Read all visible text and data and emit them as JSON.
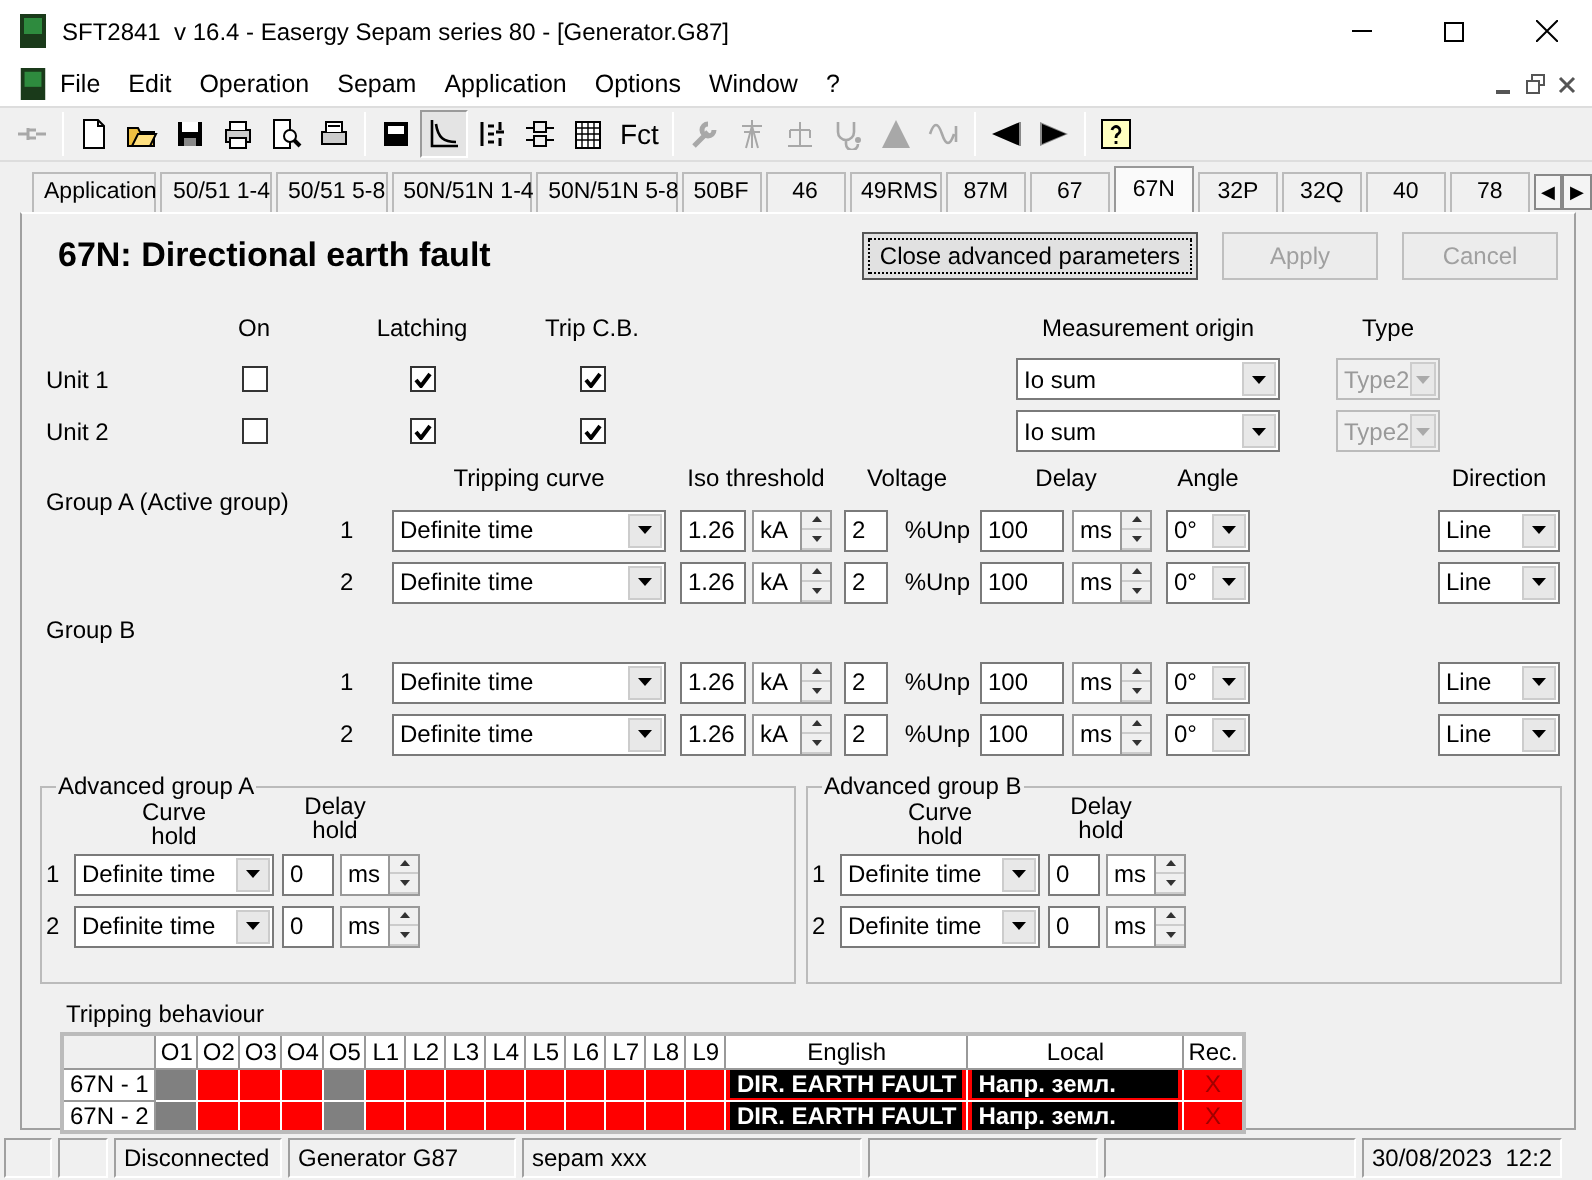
{
  "window": {
    "title": "SFT2841  v 16.4 - Easergy Sepam series 80 - [Generator.G87]"
  },
  "menu": [
    "File",
    "Edit",
    "Operation",
    "Sepam",
    "Application",
    "Options",
    "Window",
    "?"
  ],
  "toolbar": {
    "function_label": "Fct",
    "buttons": [
      {
        "disabled": true,
        "pressed": false
      },
      {
        "disabled": false,
        "pressed": false
      },
      {
        "disabled": false,
        "pressed": false
      },
      {
        "disabled": false,
        "pressed": false
      },
      {
        "disabled": false,
        "pressed": false
      },
      {
        "disabled": false,
        "pressed": false
      },
      {
        "disabled": false,
        "pressed": false
      },
      {
        "disabled": false,
        "pressed": false
      },
      {
        "disabled": false,
        "pressed": true
      },
      {
        "disabled": false,
        "pressed": false
      },
      {
        "disabled": false,
        "pressed": false
      },
      {
        "disabled": false,
        "pressed": false
      },
      {
        "disabled": true,
        "pressed": false
      },
      {
        "disabled": true,
        "pressed": false
      },
      {
        "disabled": true,
        "pressed": false
      },
      {
        "disabled": true,
        "pressed": false
      },
      {
        "disabled": true,
        "pressed": false
      },
      {
        "disabled": true,
        "pressed": false
      },
      {
        "disabled": false,
        "pressed": false
      },
      {
        "disabled": false,
        "pressed": false
      },
      {
        "disabled": false,
        "pressed": false
      }
    ]
  },
  "tabs": [
    {
      "label": "Application",
      "selected": false
    },
    {
      "label": "50/51 1-4",
      "selected": false
    },
    {
      "label": "50/51 5-8",
      "selected": false
    },
    {
      "label": "50N/51N 1-4",
      "selected": false
    },
    {
      "label": "50N/51N 5-8",
      "selected": false
    },
    {
      "label": "50BF",
      "selected": false
    },
    {
      "label": "46",
      "selected": false
    },
    {
      "label": "49RMS",
      "selected": false
    },
    {
      "label": "87M",
      "selected": false
    },
    {
      "label": "67",
      "selected": false
    },
    {
      "label": "67N",
      "selected": true
    },
    {
      "label": "32P",
      "selected": false
    },
    {
      "label": "32Q",
      "selected": false
    },
    {
      "label": "40",
      "selected": false
    },
    {
      "label": "78",
      "selected": false
    }
  ],
  "tab_scroll": [
    "◀",
    "▶"
  ],
  "panel": {
    "heading": "67N: Directional earth fault",
    "buttons": [
      {
        "label": "Close advanced parameters",
        "disabled": false
      },
      {
        "label": "Apply",
        "disabled": true
      },
      {
        "label": "Cancel",
        "disabled": true
      }
    ]
  },
  "units": {
    "columns": [
      "On",
      "Latching",
      "Trip C.B.",
      "Measurement origin",
      "Type"
    ],
    "rows": [
      {
        "label": "Unit 1",
        "on": false,
        "latching": true,
        "trip_cb": true,
        "measurement_origin": "Io sum",
        "type": "Type2",
        "type_disabled": true
      },
      {
        "label": "Unit 2",
        "on": false,
        "latching": true,
        "trip_cb": true,
        "measurement_origin": "Io sum",
        "type": "Type2",
        "type_disabled": true
      }
    ]
  },
  "groups": {
    "columns": [
      "Tripping curve",
      "Iso threshold",
      "Voltage",
      "Delay",
      "Angle",
      "Direction"
    ],
    "items": [
      {
        "label": "Group A  (Active group)",
        "rows": [
          {
            "index": "1",
            "curve": "Definite time",
            "threshold": "1.26",
            "threshold_unit": "kA",
            "voltage": "2",
            "voltage_unit": "%Unp",
            "delay": "100",
            "delay_unit": "ms",
            "angle": "0°",
            "direction": "Line"
          },
          {
            "index": "2",
            "curve": "Definite time",
            "threshold": "1.26",
            "threshold_unit": "kA",
            "voltage": "2",
            "voltage_unit": "%Unp",
            "delay": "100",
            "delay_unit": "ms",
            "angle": "0°",
            "direction": "Line"
          }
        ]
      },
      {
        "label": "Group B",
        "rows": [
          {
            "index": "1",
            "curve": "Definite time",
            "threshold": "1.26",
            "threshold_unit": "kA",
            "voltage": "2",
            "voltage_unit": "%Unp",
            "delay": "100",
            "delay_unit": "ms",
            "angle": "0°",
            "direction": "Line"
          },
          {
            "index": "2",
            "curve": "Definite time",
            "threshold": "1.26",
            "threshold_unit": "kA",
            "voltage": "2",
            "voltage_unit": "%Unp",
            "delay": "100",
            "delay_unit": "ms",
            "angle": "0°",
            "direction": "Line"
          }
        ]
      }
    ]
  },
  "advanced": [
    {
      "title": "Advanced group A",
      "columns": [
        "Curve hold",
        "Delay hold"
      ],
      "rows": [
        {
          "index": "1",
          "curve": "Definite time",
          "delay": "0",
          "delay_unit": "ms"
        },
        {
          "index": "2",
          "curve": "Definite time",
          "delay": "0",
          "delay_unit": "ms"
        }
      ]
    },
    {
      "title": "Advanced group B",
      "columns": [
        "Curve hold",
        "Delay hold"
      ],
      "rows": [
        {
          "index": "1",
          "curve": "Definite time",
          "delay": "0",
          "delay_unit": "ms"
        },
        {
          "index": "2",
          "curve": "Definite time",
          "delay": "0",
          "delay_unit": "ms"
        }
      ]
    }
  ],
  "tripping": {
    "title": "Tripping behaviour",
    "columns": [
      "O1",
      "O2",
      "O3",
      "O4",
      "O5",
      "L1",
      "L2",
      "L3",
      "L4",
      "L5",
      "L6",
      "L7",
      "L8",
      "L9",
      "English",
      "Local",
      "Rec."
    ],
    "rows": [
      {
        "label": "67N - 1",
        "outputs": [
          false,
          true,
          true,
          true,
          false,
          true,
          true,
          true,
          true,
          true,
          true,
          true,
          true,
          true
        ],
        "english": "DIR. EARTH FAULT",
        "local": "Напр. земл.",
        "rec": "X"
      },
      {
        "label": "67N - 2",
        "outputs": [
          false,
          true,
          true,
          true,
          false,
          true,
          true,
          true,
          true,
          true,
          true,
          true,
          true,
          true
        ],
        "english": "DIR. EARTH FAULT",
        "local": "Напр. земл.",
        "rec": "X"
      }
    ]
  },
  "status_bar": [
    "Disconnected",
    "Generator G87",
    "sepam xxx",
    "30/08/2023  12:2"
  ]
}
